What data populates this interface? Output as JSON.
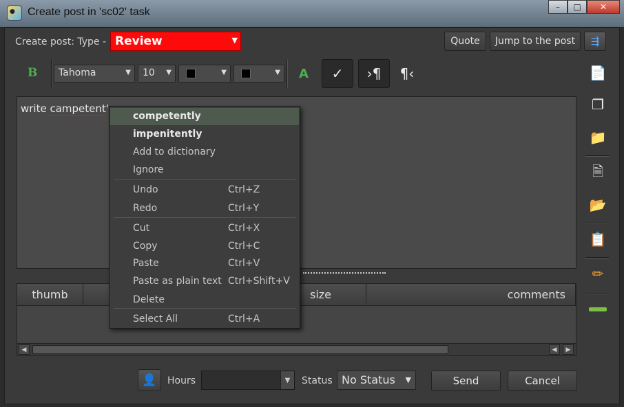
{
  "window": {
    "title": "Create post in 'sc02' task",
    "icon": "app-icon",
    "controls": [
      "minimize-icon",
      "maximize-icon",
      "close-icon"
    ]
  },
  "header": {
    "type_label": "Create post: Type -",
    "type_value": "Review",
    "type_color": "#ff0a0a",
    "quote_label": "Quote",
    "jump_label": "Jump to the post"
  },
  "toolbar": {
    "bold_label": "B",
    "font": "Tahoma",
    "size": "10",
    "text_color": "#000000",
    "bg_color": "#000000",
    "font_color_icon": "A"
  },
  "editor": {
    "text_before": "write ",
    "misspelled": "campetent",
    "text_after": "'"
  },
  "context_menu": {
    "suggestions": [
      "competently",
      "impenitently"
    ],
    "add_to_dictionary": "Add to dictionary",
    "ignore": "Ignore",
    "items": [
      {
        "label": "Undo",
        "shortcut": "Ctrl+Z"
      },
      {
        "label": "Redo",
        "shortcut": "Ctrl+Y"
      },
      {
        "label": "Cut",
        "shortcut": "Ctrl+X"
      },
      {
        "label": "Copy",
        "shortcut": "Ctrl+C"
      },
      {
        "label": "Paste",
        "shortcut": "Ctrl+V"
      },
      {
        "label": "Paste as plain text",
        "shortcut": "Ctrl+Shift+V"
      },
      {
        "label": "Delete",
        "shortcut": ""
      },
      {
        "label": "Select All",
        "shortcut": "Ctrl+A"
      }
    ]
  },
  "attachments": {
    "columns": [
      "thumb",
      "",
      "size",
      "comments"
    ]
  },
  "footer": {
    "hours_label": "Hours",
    "hours_value": "",
    "status_label": "Status",
    "status_value": "No Status",
    "send_label": "Send",
    "cancel_label": "Cancel"
  }
}
